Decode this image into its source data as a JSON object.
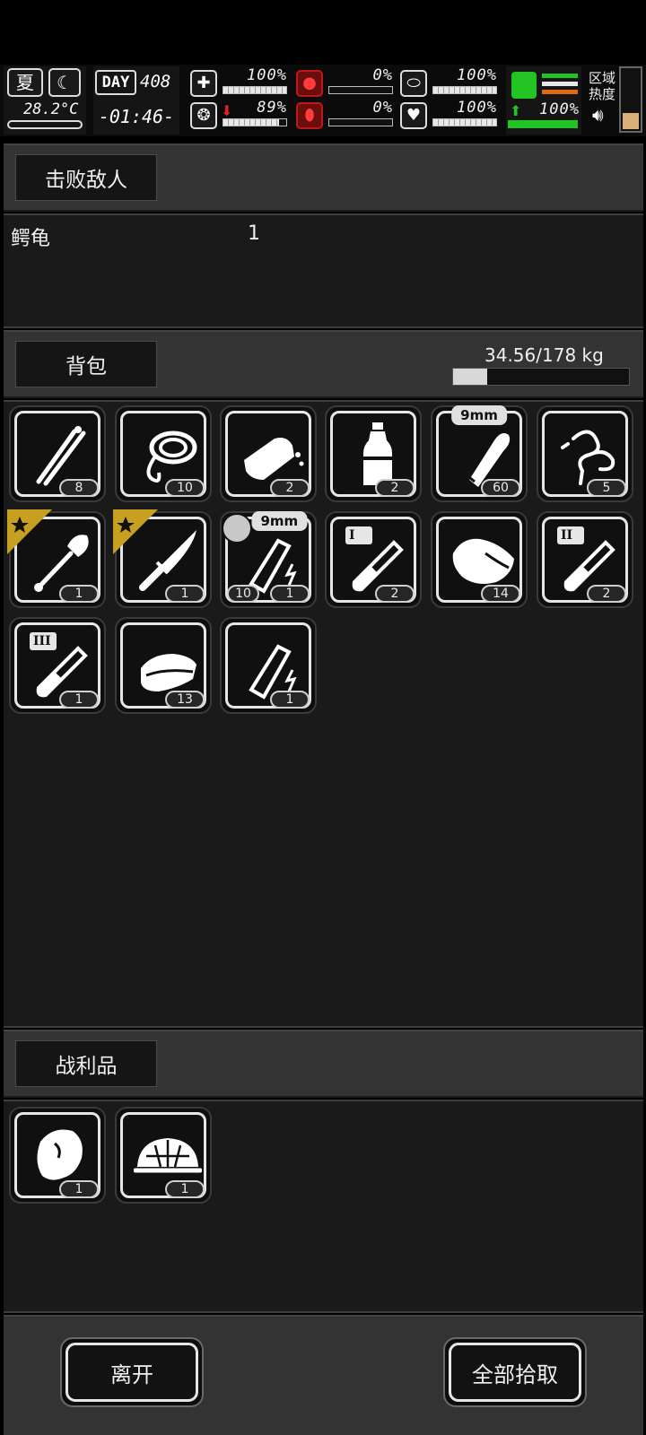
{
  "hud": {
    "season": "夏",
    "temperature": "28.2°C",
    "day_label": "DAY",
    "day": "408",
    "time": "-01:46-",
    "stats": {
      "health": "100%",
      "hunger": "0%",
      "energy": "100%",
      "mood": "89%",
      "bleeding": "0%",
      "stamina": "100%",
      "move_speed": "100%"
    },
    "stat_levels": {
      "health": 1.0,
      "mood": 0.89,
      "hunger": 0.0,
      "bleeding": 0.0,
      "energy": 1.0,
      "stamina": 1.0,
      "move_speed": 1.0
    },
    "area_heat_line1": "区域",
    "area_heat_line2": "热度"
  },
  "defeated": {
    "header": "击败敌人",
    "enemies": [
      {
        "name": "鳄龟",
        "count": "1"
      }
    ]
  },
  "backpack": {
    "header": "背包",
    "weight": "34.56/178 kg",
    "weight_fraction": 0.194,
    "items": [
      {
        "icon": "tweezers-icon",
        "count": "8"
      },
      {
        "icon": "rope-icon",
        "count": "10"
      },
      {
        "icon": "bread-icon",
        "count": "2"
      },
      {
        "icon": "water-bottle-icon",
        "count": "2"
      },
      {
        "icon": "bullet-icon",
        "count": "60",
        "tag": "9mm"
      },
      {
        "icon": "cord-icon",
        "count": "5"
      },
      {
        "icon": "shovel-icon",
        "count": "1",
        "starred": true
      },
      {
        "icon": "knife-icon",
        "count": "1",
        "starred": true
      },
      {
        "icon": "pistol-magazine-icon",
        "count": "1",
        "count2": "10",
        "tag": "9mm"
      },
      {
        "icon": "test-tube-icon",
        "count": "2",
        "tier": "I"
      },
      {
        "icon": "raw-meat-icon",
        "count": "14"
      },
      {
        "icon": "test-tube-icon",
        "count": "2",
        "tier": "II"
      },
      {
        "icon": "test-tube-icon",
        "count": "1",
        "tier": "III"
      },
      {
        "icon": "cloth-icon",
        "count": "13"
      },
      {
        "icon": "magazine-icon",
        "count": "1"
      }
    ]
  },
  "loot": {
    "header": "战利品",
    "items": [
      {
        "icon": "meat-icon",
        "count": "1"
      },
      {
        "icon": "turtle-shell-icon",
        "count": "1"
      }
    ]
  },
  "actions": {
    "leave": "离开",
    "pick_all": "全部拾取"
  }
}
